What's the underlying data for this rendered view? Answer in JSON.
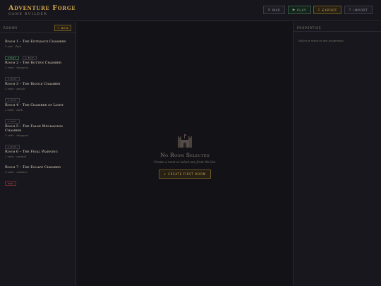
{
  "app": {
    "title": "Adventure Forge",
    "subtitle": "Game Builder"
  },
  "toolbar": {
    "map": {
      "icon": "⊙",
      "label": "Map"
    },
    "play": {
      "icon": "▶",
      "label": "Play"
    },
    "export": {
      "icon": "⇩",
      "label": "Export"
    },
    "import": {
      "icon": "⇧",
      "label": "Import"
    }
  },
  "rooms_panel": {
    "label": "Rooms",
    "new_button": "+ New",
    "rooms": [
      {
        "title": "Room 1 – The Entrance Chamber",
        "meta": "1 exit · dark",
        "tags": [
          "start",
          "1 exit"
        ]
      },
      {
        "title": "Room 2 – The Rotten Chamber",
        "meta": "2 exits · dungeon",
        "tags": [
          "1 exit"
        ]
      },
      {
        "title": "Room 3 – The Riddle Chamber",
        "meta": "2 exits · puzzle",
        "tags": [
          "1 exit"
        ]
      },
      {
        "title": "Room 4 – The Chamber of Light",
        "meta": "2 exits · dark",
        "tags": [
          "1 exit"
        ]
      },
      {
        "title": "Room 5 – The False Mechanism Chamber",
        "meta": "2 exits · dungeon",
        "tags": [
          "1 exit"
        ]
      },
      {
        "title": "Room 6 – The Final Warning",
        "meta": "2 exits · normal",
        "tags": []
      },
      {
        "title": "Room 7 – The Escape Chamber",
        "meta": "0 exits · outdoor",
        "tags": [
          "end"
        ]
      }
    ]
  },
  "main": {
    "empty_icon": "castle-icon",
    "empty_title": "No Room Selected",
    "empty_hint": "Create a room or select one from the list.",
    "create_button": "+ Create First Room"
  },
  "properties_panel": {
    "label": "Properties",
    "hint": "Select a room to see properties."
  },
  "colors": {
    "accent_gold": "#d6a84a",
    "play_green": "#6fbf8a",
    "end_red": "#d06060",
    "background": "#141318"
  }
}
